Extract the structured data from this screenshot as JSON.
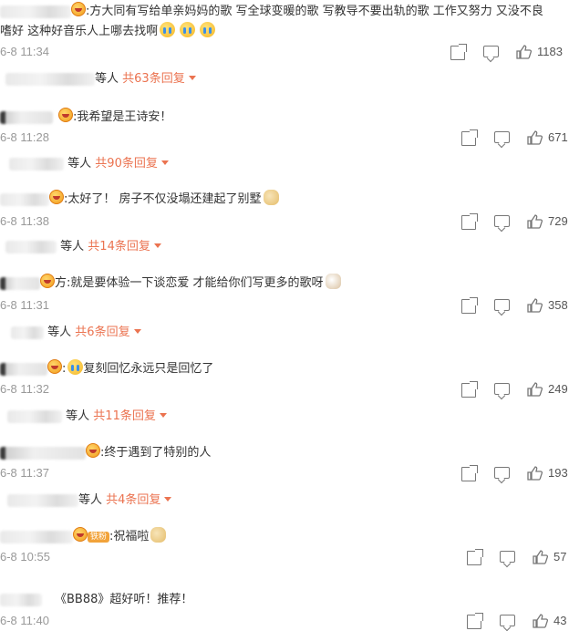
{
  "comments": [
    {
      "text1": ":方大同有写给单亲妈妈的歌 写全球变暖的歌 写教导不要出轨的歌 工作又努力 又没不良",
      "text2": "嗜好 这种好音乐人上哪去找啊",
      "time": "6-8 11:34",
      "likes": "1183",
      "reply_prefix": "等人",
      "reply_link": "共63条回复"
    },
    {
      "text1": ":我希望是王诗安！",
      "time": "6-8 11:28",
      "likes": "671",
      "reply_prefix": "等人",
      "reply_link": "共90条回复"
    },
    {
      "text1": ":太好了！ 房子不仅没塌还建起了别墅",
      "time": "6-8 11:38",
      "likes": "729",
      "reply_prefix": "等人",
      "reply_link": "共14条回复"
    },
    {
      "text1": "方:就是要体验一下谈恋爱 才能给你们写更多的歌呀",
      "time": "6-8 11:31",
      "likes": "358",
      "reply_prefix": "等人",
      "reply_link": "共6条回复"
    },
    {
      "text1": "复刻回忆永远只是回忆了",
      "time": "6-8 11:32",
      "likes": "249",
      "reply_prefix": "等人",
      "reply_link": "共11条回复"
    },
    {
      "text1": ":终于遇到了特别的人",
      "time": "6-8 11:37",
      "likes": "193",
      "reply_prefix": "等人",
      "reply_link": "共4条回复"
    },
    {
      "text1": ":祝福啦",
      "fan_badge": "铁粉",
      "time": "6-8 10:55",
      "likes": "57"
    },
    {
      "text1": "《BB88》超好听！推荐！",
      "time": "6-8 11:40",
      "likes": "43"
    }
  ]
}
